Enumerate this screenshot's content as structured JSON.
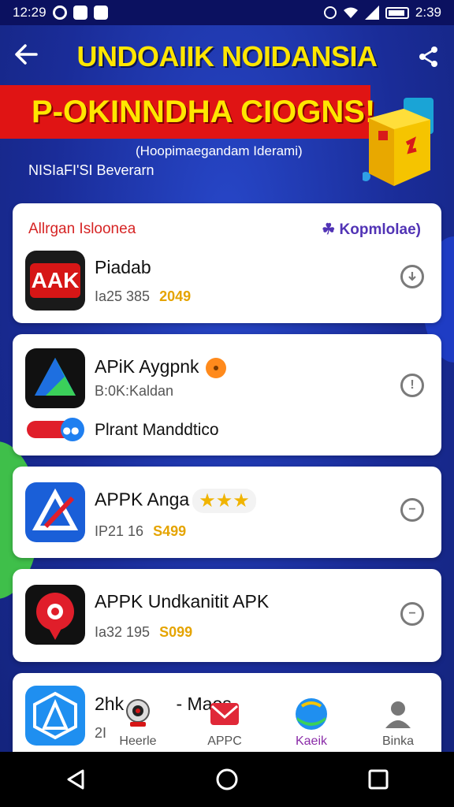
{
  "status_bar": {
    "time": "12:29",
    "right_time": "2:39"
  },
  "header": {
    "title": "UNDOAIIK NOIDANSIA"
  },
  "banner": {
    "title": "P-OKINNDHA CIOGNS!",
    "subtitle": "(Hoopimaegandam Iderami)",
    "subtitle2": "NISIaFI'SI Beverarn"
  },
  "section": {
    "title": "Allrgan Isloonea",
    "link": "☘ Kopmlolae)"
  },
  "apps": [
    {
      "name": "Piadab",
      "meta": "Ia25 385",
      "meta_gold": "2049",
      "icon_text": "AAK"
    },
    {
      "name": "APiK Aygpnk",
      "meta": "B:0K:Kaldan",
      "promo": "Plrant Manddtico"
    },
    {
      "name": "APPK Anga",
      "meta": "IР21 16",
      "meta_gold": "S499",
      "stars": "★★★"
    },
    {
      "name": "APPK Undkanitit APK",
      "meta": "Ia32 195",
      "meta_gold": "S099"
    },
    {
      "name": "2hk",
      "name_suffix": "- Maos",
      "meta": "2І"
    }
  ],
  "bottom_nav": [
    {
      "label": "Heerle",
      "icon": "camera-icon"
    },
    {
      "label": "APPC",
      "icon": "mail-icon"
    },
    {
      "label": "Kaeik",
      "icon": "globe-icon",
      "active": true
    },
    {
      "label": "Binka",
      "icon": "person-icon"
    }
  ],
  "colors": {
    "accent_yellow": "#ffe600",
    "banner_red": "#e01414",
    "bg_blue": "#1b2f9e"
  }
}
